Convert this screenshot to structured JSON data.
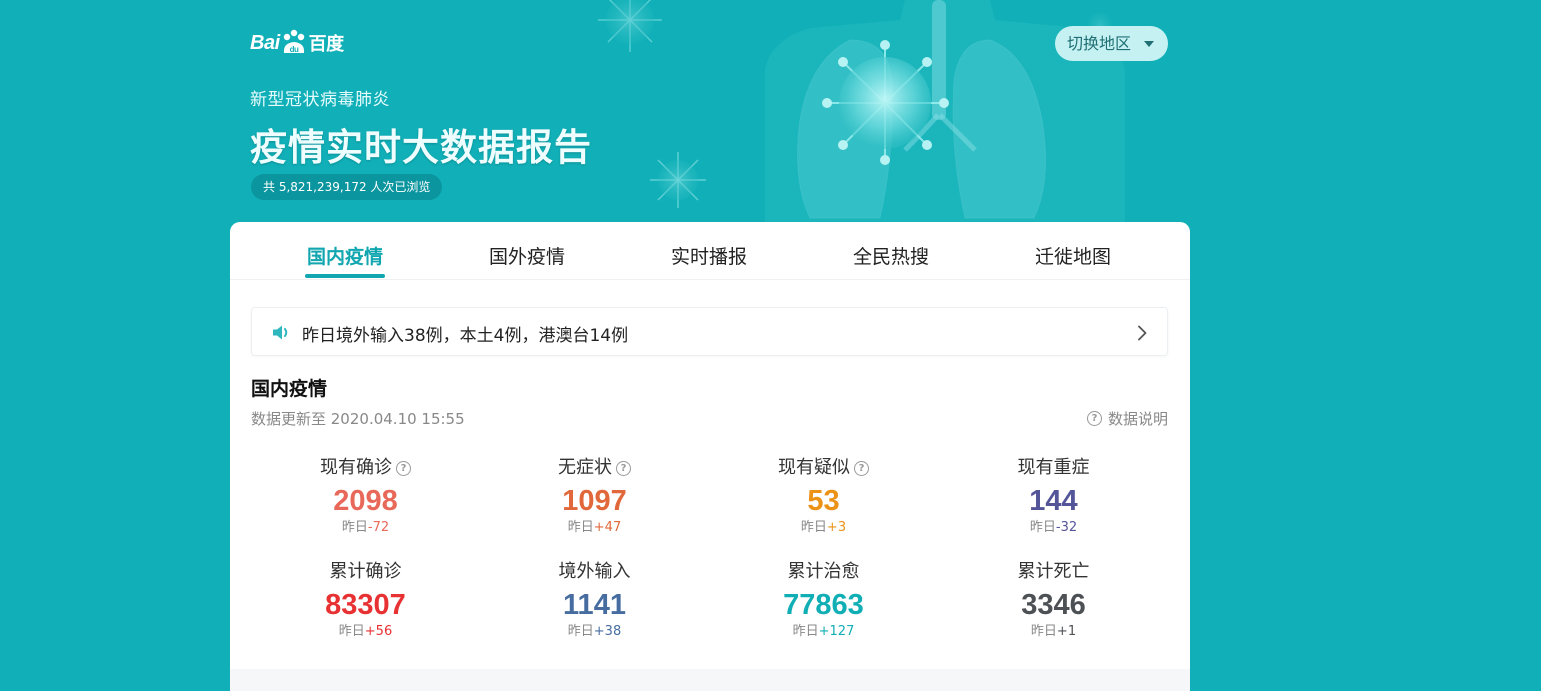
{
  "header": {
    "logo_latin": "Bai",
    "logo_du": "du",
    "logo_cn": "百度",
    "subtitle": "新型冠状病毒肺炎",
    "title": "疫情实时大数据报告",
    "views": "共 5,821,239,172 人次已浏览",
    "region_button": "切换地区"
  },
  "tabs": [
    {
      "label": "国内疫情",
      "active": true
    },
    {
      "label": "国外疫情",
      "active": false
    },
    {
      "label": "实时播报",
      "active": false
    },
    {
      "label": "全民热搜",
      "active": false
    },
    {
      "label": "迁徙地图",
      "active": false
    }
  ],
  "notice": {
    "icon": "speaker-icon",
    "text": "昨日境外输入38例，本土4例，港澳台14例"
  },
  "section": {
    "title": "国内疫情",
    "update_time": "数据更新至 2020.04.10 15:55",
    "data_note": "数据说明"
  },
  "stats": [
    {
      "label": "现有确诊",
      "value": "2098",
      "delta_prefix": "昨日",
      "delta": "-72",
      "color": "#e8685a",
      "help": true
    },
    {
      "label": "无症状",
      "value": "1097",
      "delta_prefix": "昨日",
      "delta": "+47",
      "color": "#e1683a",
      "help": true
    },
    {
      "label": "现有疑似",
      "value": "53",
      "delta_prefix": "昨日",
      "delta": "+3",
      "color": "#ec9217",
      "help": true
    },
    {
      "label": "现有重症",
      "value": "144",
      "delta_prefix": "昨日",
      "delta": "-32",
      "color": "#545499",
      "help": false
    },
    {
      "label": "累计确诊",
      "value": "83307",
      "delta_prefix": "昨日",
      "delta": "+56",
      "color": "#e83132",
      "help": false
    },
    {
      "label": "境外输入",
      "value": "1141",
      "delta_prefix": "昨日",
      "delta": "+38",
      "color": "#476da0",
      "help": false
    },
    {
      "label": "累计治愈",
      "value": "77863",
      "delta_prefix": "昨日",
      "delta": "+127",
      "color": "#10aeb5",
      "help": false
    },
    {
      "label": "累计死亡",
      "value": "3346",
      "delta_prefix": "昨日",
      "delta": "+1",
      "color": "#4d5054",
      "help": false
    }
  ]
}
